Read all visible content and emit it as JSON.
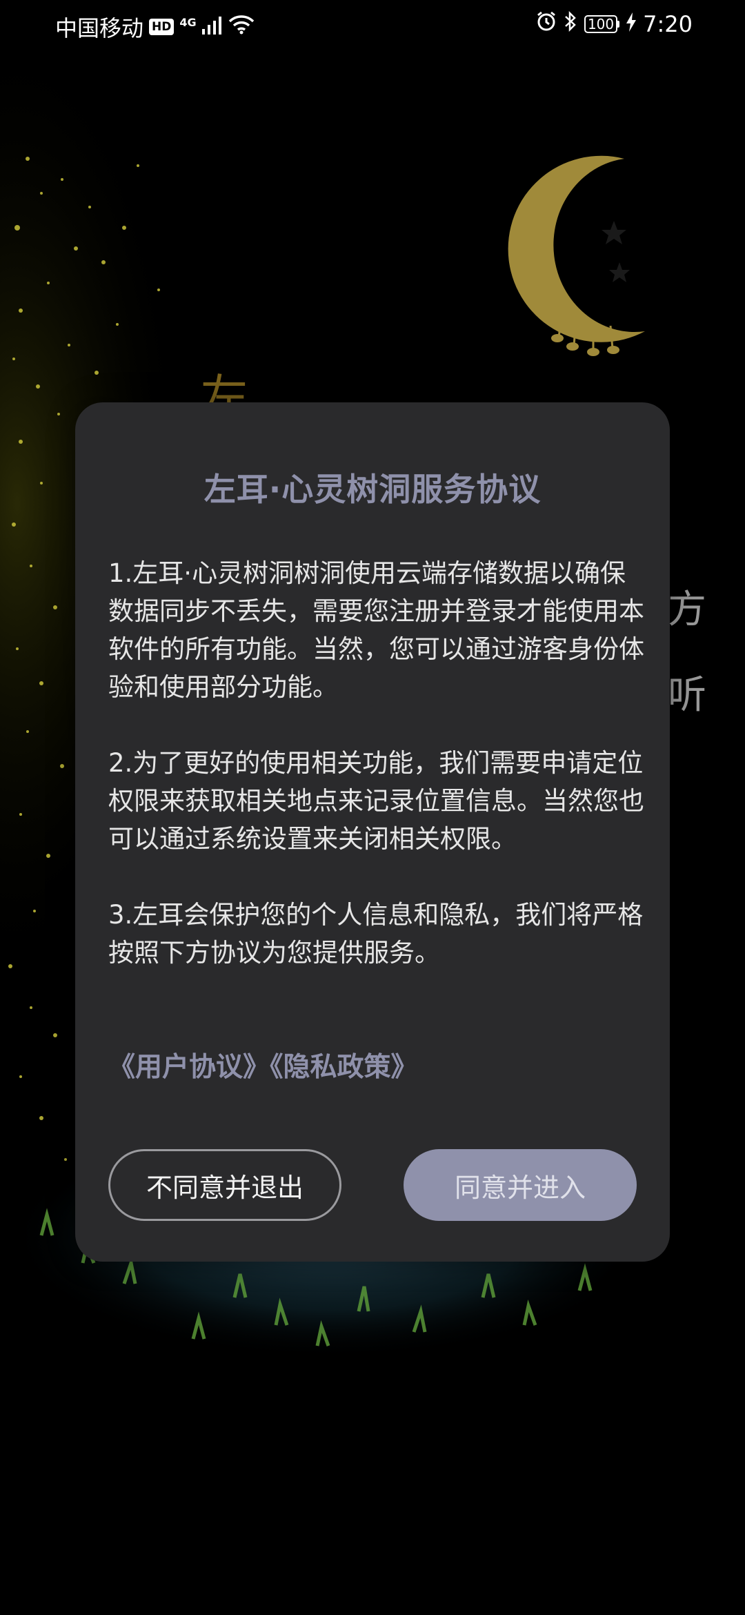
{
  "status_bar": {
    "carrier": "中国移动",
    "hd": "HD",
    "network": "4G",
    "battery": "100",
    "time": "7:20",
    "icons": [
      "signal-icon",
      "wifi-icon",
      "alarm-icon",
      "bluetooth-icon",
      "battery-icon",
      "charging-icon"
    ]
  },
  "background": {
    "partial_text_1": "方",
    "partial_text_2": "听"
  },
  "dialog": {
    "title": "左耳·心灵树洞服务协议",
    "paragraphs": [
      "1.左耳·心灵树洞树洞使用云端存储数据以确保数据同步不丢失，需要您注册并登录才能使用本软件的所有功能。当然，您可以通过游客身份体验和使用部分功能。",
      "2.为了更好的使用相关功能，我们需要申请定位权限来获取相关地点来记录位置信息。当然您也可以通过系统设置来关闭相关权限。",
      "3.左耳会保护您的个人信息和隐私，我们将严格按照下方协议为您提供服务。"
    ],
    "link_user_agreement": "《用户协议》",
    "link_privacy_policy": "《隐私政策》",
    "disagree_button": "不同意并退出",
    "agree_button": "同意并进入"
  },
  "colors": {
    "accent": "#8f91ab",
    "dialog_bg": "#2a2a2c",
    "moon": "#a08a3a"
  }
}
